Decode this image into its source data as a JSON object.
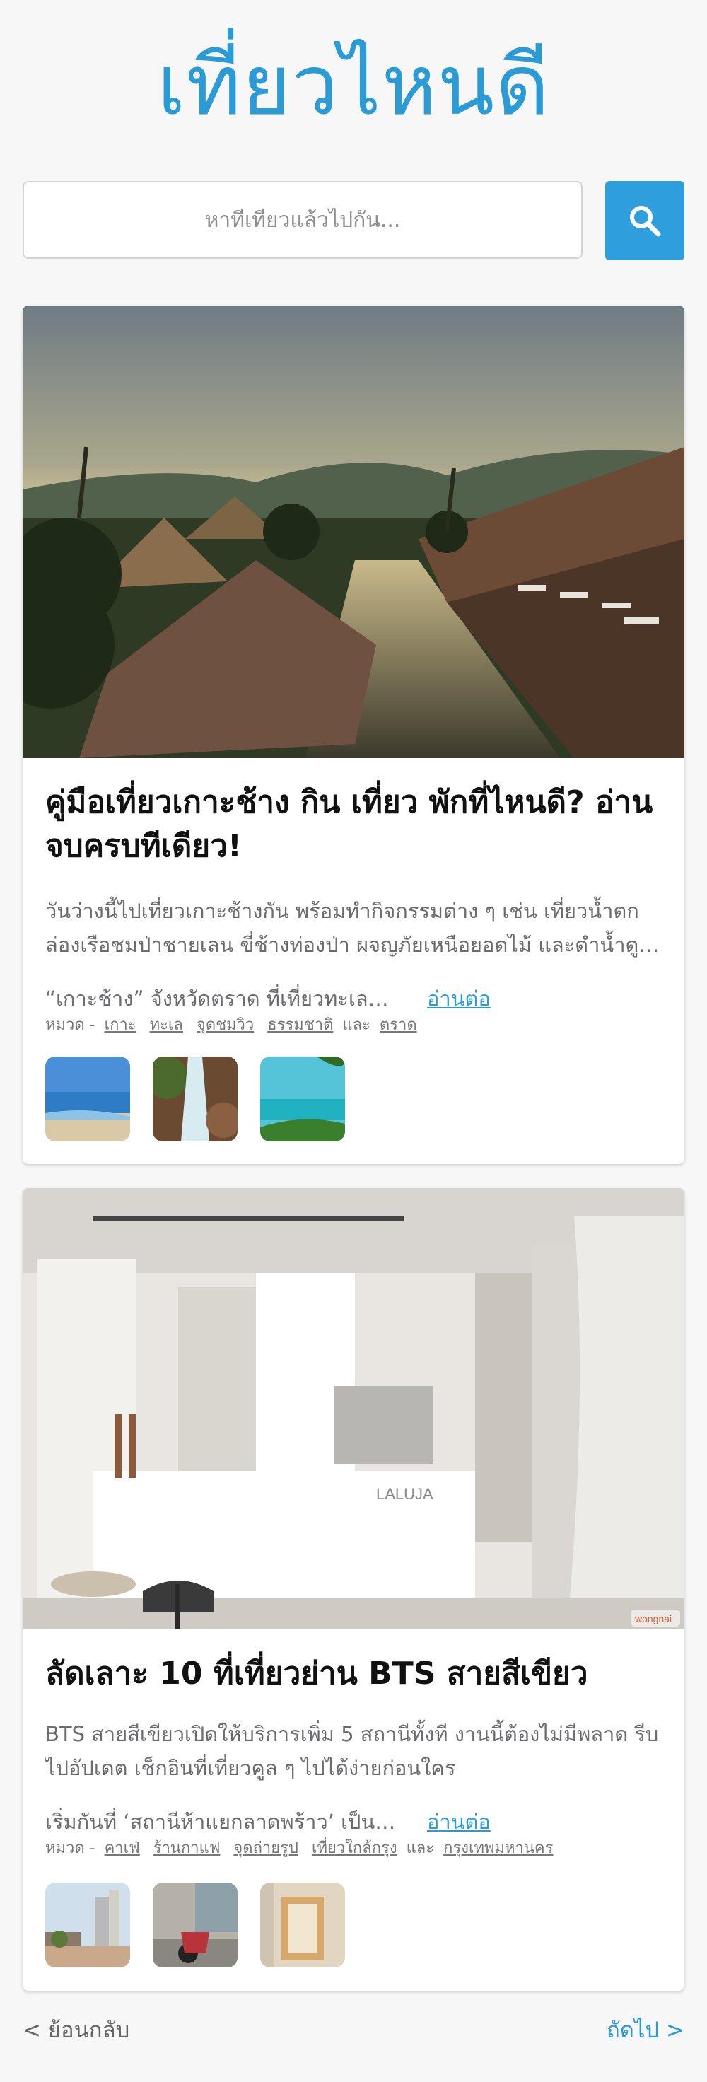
{
  "header": {
    "title": "เที่ยวไหนดี"
  },
  "search": {
    "placeholder": "หาที่เที่ยวแล้วไปกัน..."
  },
  "articles": [
    {
      "title": "คู่มือเที่ยวเกาะช้าง กิน เที่ยว พักที่ไหนดี? อ่านจบครบทีเดียว!",
      "description": "วันว่างนี้ไปเที่ยวเกาะช้างกัน พร้อมทำกิจกรรมต่าง ๆ เช่น เที่ยวน้ำตก ล่องเรือชมป่าชายเลน ขี่ช้างท่องป่า ผจญภัยเหนือยอดไม้ และดำน้ำดูปะการัง",
      "excerpt": "“เกาะช้าง” จังหวัดตราด ที่เที่ยวทะเลสวยที่ใกล้กรุงเทพฯ",
      "read_more": "อ่านต่อ",
      "category_label": "หมวด -",
      "tags": [
        "เกาะ",
        "ทะเล",
        "จุดชมวิว",
        "ธรรมชาติ"
      ],
      "and_label": "และ",
      "location": "ตราด"
    },
    {
      "title": "ลัดเลาะ 10 ที่เที่ยวย่าน BTS สายสีเขียว",
      "description": "BTS สายสีเขียวเปิดให้บริการเพิ่ม 5 สถานีทั้งที งานนี้ต้องไม่มีพลาด รีบไปอัปเดต เช็กอินที่เที่ยวคูล ๆ ไปได้ง่ายก่อนใคร",
      "excerpt": "เริ่มกันที่ ‘สถานีห้าแยกลาดพร้าว’ เป็นสถานีแรก",
      "read_more": "อ่านต่อ",
      "category_label": "หมวด -",
      "tags": [
        "คาเฟ่",
        "ร้านกาแฟ",
        "จุดถ่ายรูป",
        "เที่ยวใกล้กรุง"
      ],
      "and_label": "และ",
      "location": "กรุงเทพมหานคร",
      "image_watermark": "wongnai",
      "counter_sign": "LALUJA"
    }
  ],
  "pagination": {
    "prev": "< ย้อนกลับ",
    "next": "ถัดไป >"
  },
  "colors": {
    "accent": "#2b9bd8",
    "button": "#2e9fdc",
    "text_muted": "#6b6b70"
  }
}
